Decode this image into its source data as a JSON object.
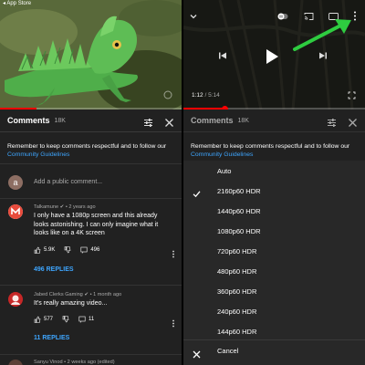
{
  "status_bar": {
    "back_label": "◂ App Store"
  },
  "left": {
    "player": {
      "progress_fraction": 0.2
    },
    "comments": {
      "title": "Comments",
      "count": "18K",
      "notice_text": "Remember to keep comments respectful and to follow our ",
      "notice_link": "Community Guidelines",
      "add_placeholder": "Add a public comment...",
      "avatar_letter": "a"
    },
    "items": [
      {
        "author_meta": "Talkamune ✔ • 2 years ago",
        "text": "I only have a 1080p screen and this already looks astonishing. I can only imagine what it looks like on a 4K screen",
        "likes": "5.9K",
        "reply_count": "496",
        "replies_label": "496 REPLIES"
      },
      {
        "author_meta": "Jabed Clerks Gaming ✔ • 1 month ago",
        "text": "It's really amazing video...",
        "likes": "577",
        "reply_count": "11",
        "replies_label": "11 REPLIES"
      },
      {
        "author_meta": "Sanyu Vinod • 2 weeks ago (edited)"
      }
    ]
  },
  "right": {
    "player": {
      "time_current": "1:12",
      "time_sep": " / ",
      "time_total": "5:14",
      "progress_fraction": 0.23
    },
    "comments": {
      "title": "Comments",
      "count": "18K",
      "notice_text": "Remember to keep comments respectful and to follow our ",
      "notice_link": "Community Guidelines"
    },
    "quality_options": [
      {
        "label": "Auto",
        "selected": false
      },
      {
        "label": "2160p60 HDR",
        "selected": true
      },
      {
        "label": "1440p60 HDR",
        "selected": false
      },
      {
        "label": "1080p60 HDR",
        "selected": false
      },
      {
        "label": "720p60 HDR",
        "selected": false
      },
      {
        "label": "480p60 HDR",
        "selected": false
      },
      {
        "label": "360p60 HDR",
        "selected": false
      },
      {
        "label": "240p60 HDR",
        "selected": false
      },
      {
        "label": "144p60 HDR",
        "selected": false
      }
    ],
    "cancel_label": "Cancel"
  },
  "colors": {
    "accent_link": "#3ea6ff",
    "progress": "#ff0000",
    "annotation_arrow": "#2ecc40"
  }
}
